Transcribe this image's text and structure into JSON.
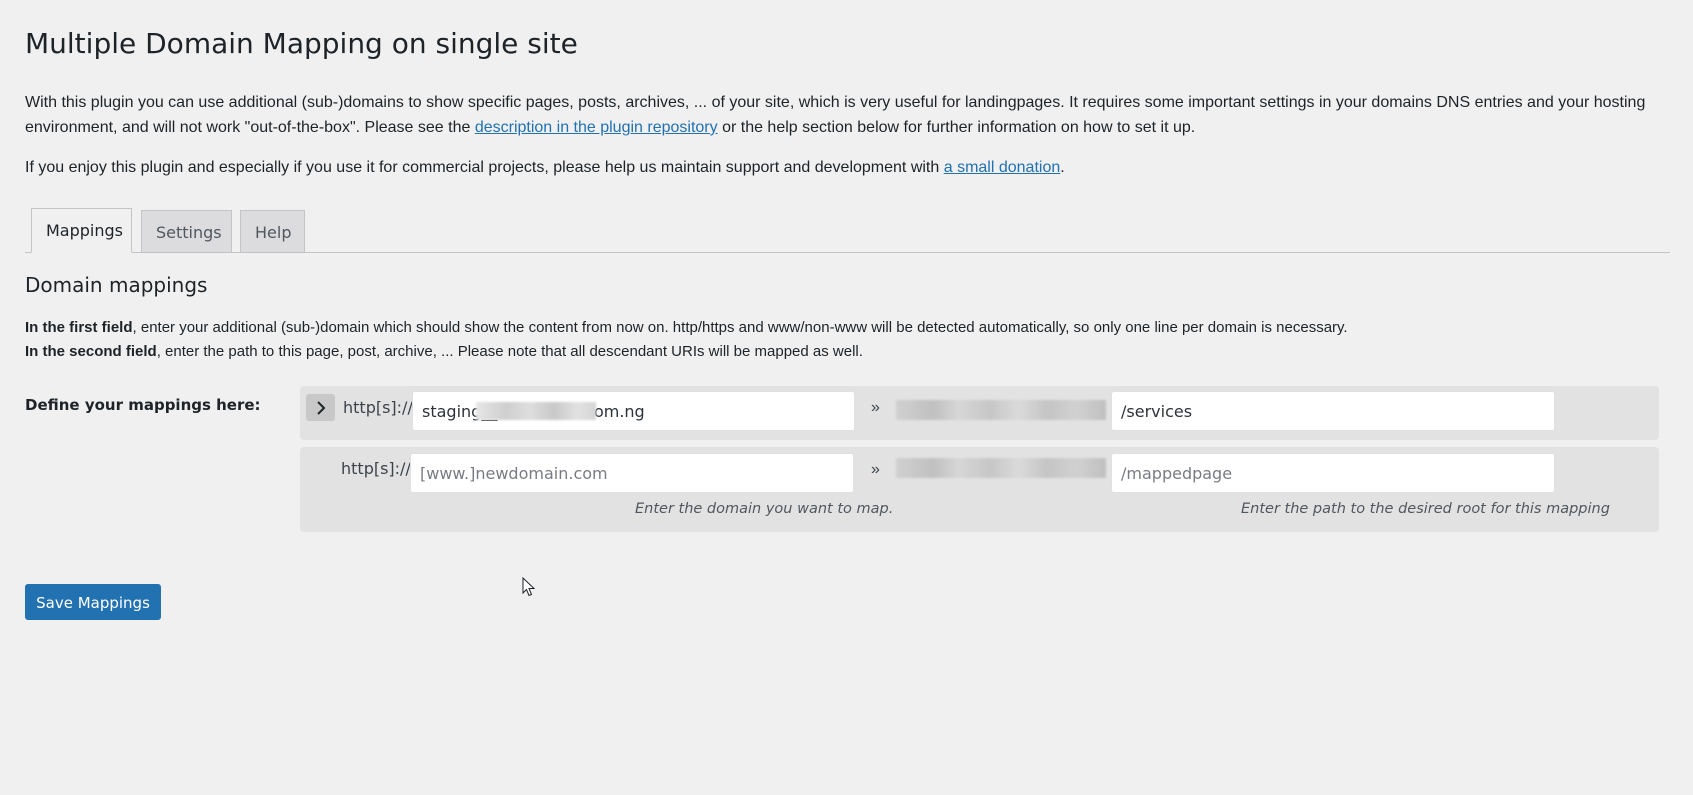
{
  "page": {
    "title": "Multiple Domain Mapping on single site",
    "intro_text_1": "With this plugin you can use additional (sub-)domains to show specific pages, posts, archives, ... of your site, which is very useful for landingpages. It requires some important settings in your domains DNS entries and your hosting environment, and will not work \"out-of-the-box\". Please see the ",
    "intro_link": "description in the plugin repository",
    "intro_text_2": " or the help section below for further information on how to set it up.",
    "donate_text_1": "If you enjoy this plugin and especially if you use it for commercial projects, please help us maintain support and development with ",
    "donate_link": "a small donation",
    "donate_text_2": "."
  },
  "tabs": [
    {
      "label": "Mappings",
      "active": true
    },
    {
      "label": "Settings",
      "active": false
    },
    {
      "label": "Help",
      "active": false
    }
  ],
  "section": {
    "title": "Domain mappings",
    "line1_bold": "In the first field",
    "line1_rest": ", enter your additional (sub-)domain which should show the content from now on. http/https and www/non-www will be detected automatically, so only one line per domain is necessary.",
    "line2_bold": "In the second field",
    "line2_rest": ", enter the path to this page, post, archive, ... Please note that all descendant URIs will be mapped as well."
  },
  "form": {
    "label": "Define your mappings here:",
    "mappings": [
      {
        "protocol": "http[s]://",
        "domain_value": "staging__                   om.ng",
        "domain_placeholder": "",
        "separator": "»",
        "path_value": "/services",
        "path_placeholder": ""
      },
      {
        "protocol": "http[s]://",
        "domain_value": "",
        "domain_placeholder": "[www.]newdomain.com",
        "separator": "»",
        "path_value": "",
        "path_placeholder": "/mappedpage"
      }
    ],
    "domain_hint": "Enter the domain you want to map.",
    "path_hint": "Enter the path to the desired root for this mapping"
  },
  "actions": {
    "save_label": "Save Mappings"
  },
  "colors": {
    "accent": "#2271b1",
    "background": "#f0f0f1",
    "mapping_box": "#e2e2e2"
  },
  "icons": {
    "toggle": "chevron-right-icon",
    "cursor": "mouse-pointer-icon"
  }
}
